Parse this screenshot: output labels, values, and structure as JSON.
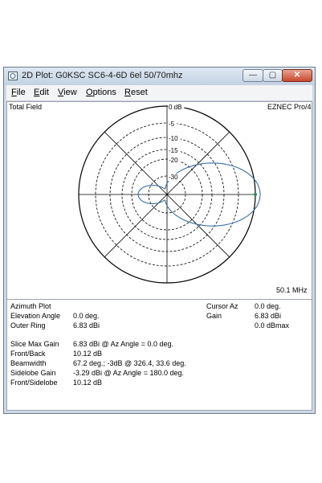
{
  "window": {
    "title": "2D Plot: G0KSC SC6-4-6D 6el 50/70mhz",
    "btn_min": "—",
    "btn_max": "▢",
    "btn_close": "✕"
  },
  "menu": [
    {
      "key": "F",
      "rest": "ile"
    },
    {
      "key": "E",
      "rest": "dit"
    },
    {
      "key": "V",
      "rest": "iew"
    },
    {
      "key": "O",
      "rest": "ptions"
    },
    {
      "key": "R",
      "rest": "eset"
    }
  ],
  "plot": {
    "field_label": "Total Field",
    "program_label": "EZNEC Pro/4",
    "ring_labels": [
      "0 dB",
      "-5",
      "-10",
      "-15",
      "-20",
      "-30"
    ],
    "frequency": "50.1 MHz"
  },
  "info": {
    "azimuth_plot": "Azimuth Plot",
    "elevation_label": "Elevation Angle",
    "elevation_value": "0.0 deg.",
    "outer_ring_label": "Outer Ring",
    "outer_ring_value": "6.83 dBi",
    "cursor_az_label": "Cursor Az",
    "cursor_az_value": "0.0 deg.",
    "gain_label": "Gain",
    "gain_value": "6.83 dBi",
    "gain_max_value": "0.0 dBmax",
    "slice_max_gain_label": "Slice Max Gain",
    "slice_max_gain_value": "6.83 dBi @ Az Angle = 0.0 deg.",
    "front_back_label": "Front/Back",
    "front_back_value": "10.12 dB",
    "beamwidth_label": "Beamwidth",
    "beamwidth_value": "67.2 deg.; -3dB @ 326.4, 33.6 deg.",
    "sidelobe_gain_label": "Sidelobe Gain",
    "sidelobe_gain_value": "-3.29 dBi @ Az Angle = 180.0 deg.",
    "front_sidelobe_label": "Front/Sidelobe",
    "front_sidelobe_value": "10.12 dB"
  },
  "colors": {
    "pattern": "#3b6fa5",
    "grid": "#000000",
    "marker": "#2e8b57"
  }
}
